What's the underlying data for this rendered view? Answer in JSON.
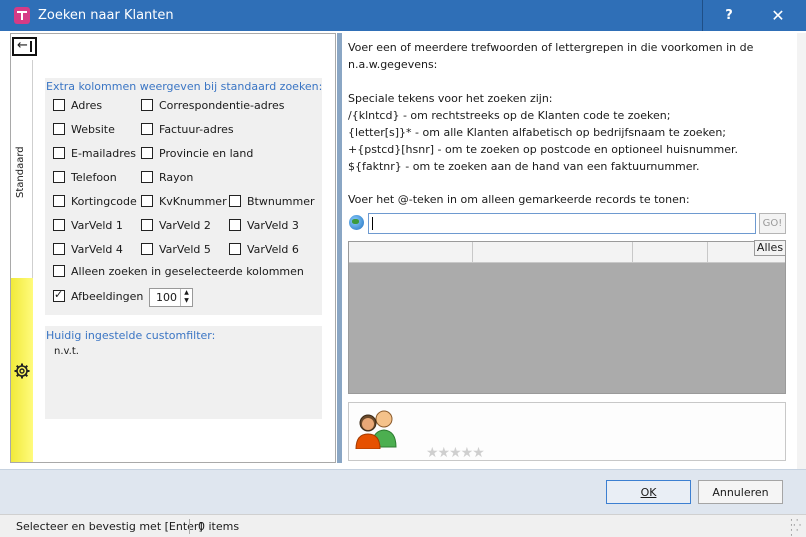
{
  "window": {
    "title": "Zoeken naar Klanten",
    "help_label": "?",
    "close_label": "✕"
  },
  "left": {
    "tab_label": "Standaard",
    "columns_group_title": "Extra kolommen weergeven bij standaard zoeken:",
    "checkboxes": [
      {
        "label": "Adres",
        "checked": false
      },
      {
        "label": "Correspondentie-adres",
        "checked": false
      },
      {
        "label": "Website",
        "checked": false
      },
      {
        "label": "Factuur-adres",
        "checked": false
      },
      {
        "label": "E-mailadres",
        "checked": false
      },
      {
        "label": "Provincie en land",
        "checked": false
      },
      {
        "label": "Telefoon",
        "checked": false
      },
      {
        "label": "Rayon",
        "checked": false
      },
      {
        "label": "Kortingcode",
        "checked": false
      },
      {
        "label": "KvKnummer",
        "checked": false
      },
      {
        "label": "Btwnummer",
        "checked": false
      },
      {
        "label": "VarVeld 1",
        "checked": false
      },
      {
        "label": "VarVeld 2",
        "checked": false
      },
      {
        "label": "VarVeld 3",
        "checked": false
      },
      {
        "label": "VarVeld 4",
        "checked": false
      },
      {
        "label": "VarVeld 5",
        "checked": false
      },
      {
        "label": "VarVeld 6",
        "checked": false
      },
      {
        "label": "Alleen zoeken in geselecteerde kolommen",
        "checked": false
      },
      {
        "label": "Afbeeldingen",
        "checked": true
      }
    ],
    "image_size_value": "100",
    "customfilter_title": "Huidig ingestelde customfilter:",
    "customfilter_value": "n.v.t."
  },
  "right": {
    "intro_line1": "Voer een of meerdere trefwoorden of lettergrepen in die voorkomen in de",
    "intro_line2": "n.a.w.gegevens:",
    "special_title": "Speciale tekens voor het zoeken zijn:",
    "special_line1": "/{klntcd}  - om rechtstreeks op de Klanten code te zoeken;",
    "special_line2": "{letter[s]}*  - om alle Klanten alfabetisch op bedrijfsnaam te zoeken;",
    "special_line3": "+{pstcd}[hsnr]  - om te zoeken op postcode en optioneel huisnummer.",
    "special_line4": "${faktnr}  - om te zoeken aan de hand van een faktuurnummer.",
    "search_label": "Voer het @-teken in om alleen gemarkeerde records te tonen:",
    "search_value": "",
    "go_label": "GO!",
    "alles_label": "Alles",
    "stars": "★★★★★"
  },
  "buttons": {
    "ok_label": "OK",
    "cancel_label": "Annuleren"
  },
  "status": {
    "hint": "Selecteer en bevestig met [Enter]",
    "count": "0 items"
  },
  "colors": {
    "titlebar": "#2f6fb7",
    "group_title": "#3a75c4",
    "tab_yellow": "#f1ea3a",
    "ok_border": "#3c7fd1"
  }
}
